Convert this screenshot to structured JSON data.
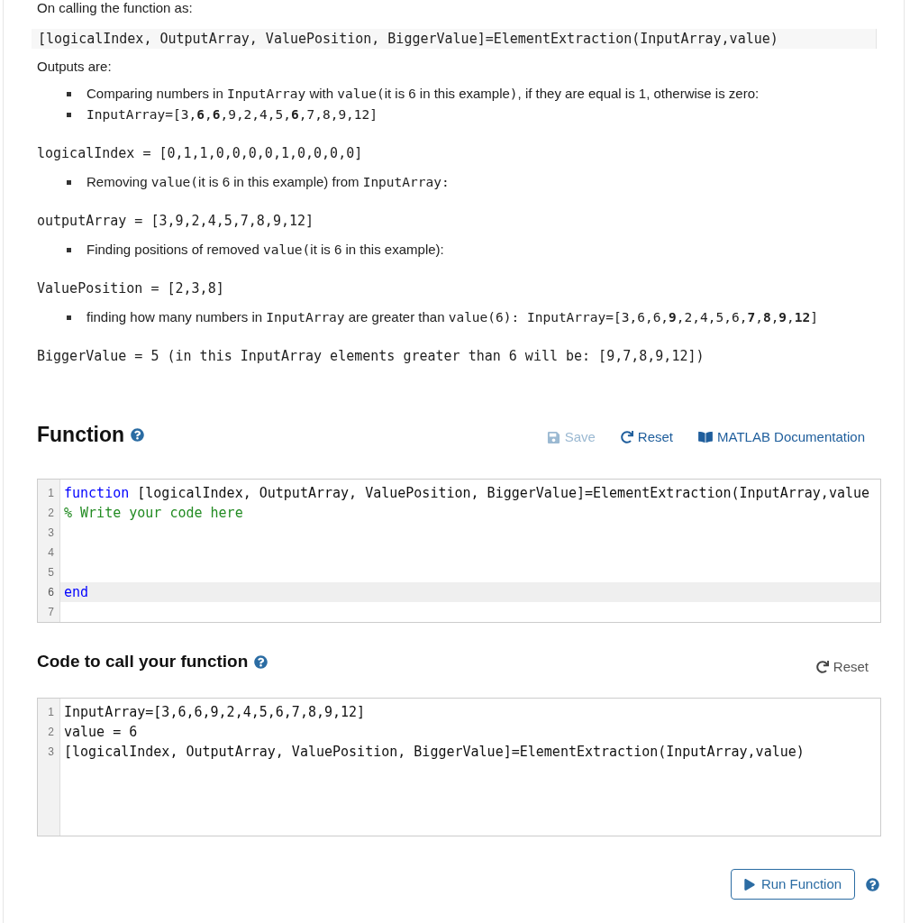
{
  "description": {
    "intro": "On calling the function as:",
    "call_code": "[logicalIndex, OutputArray, ValuePosition, BiggerValue]=ElementExtraction(InputArray,value)",
    "outputs_heading": "Outputs are:",
    "blocks": [
      {
        "kind": "bullets",
        "items": [
          {
            "segments": [
              {
                "kind": "text",
                "text": "Comparing numbers in "
              },
              {
                "kind": "code",
                "text": "InputArray"
              },
              {
                "kind": "text",
                "text": " with "
              },
              {
                "kind": "code",
                "text": "value("
              },
              {
                "kind": "text",
                "text": "it is 6 in this example"
              },
              {
                "kind": "code",
                "text": ")"
              },
              {
                "kind": "text",
                "text": ", if they are equal is 1, otherwise is zero:"
              }
            ]
          },
          {
            "segments": [
              {
                "kind": "code",
                "text": "InputArray=[3,**6**,**6**,9,2,4,5,**6**,7,8,9,12]"
              }
            ]
          }
        ]
      },
      {
        "kind": "result",
        "text": "logicalIndex = [0,1,1,0,0,0,0,1,0,0,0,0]"
      },
      {
        "kind": "bullets",
        "items": [
          {
            "segments": [
              {
                "kind": "text",
                "text": "Removing "
              },
              {
                "kind": "code",
                "text": "value("
              },
              {
                "kind": "text",
                "text": "it is 6 in this example) from "
              },
              {
                "kind": "code",
                "text": "InputArray:"
              }
            ]
          }
        ]
      },
      {
        "kind": "result",
        "text": "outputArray = [3,9,2,4,5,7,8,9,12]"
      },
      {
        "kind": "bullets",
        "items": [
          {
            "segments": [
              {
                "kind": "text",
                "text": "Finding positions of removed "
              },
              {
                "kind": "code",
                "text": "value("
              },
              {
                "kind": "text",
                "text": "it is 6 in this example):"
              }
            ]
          }
        ]
      },
      {
        "kind": "result",
        "text": "ValuePosition = [2,3,8]"
      },
      {
        "kind": "bullets",
        "items": [
          {
            "segments": [
              {
                "kind": "text",
                "text": "finding how many numbers in "
              },
              {
                "kind": "code",
                "text": "InputArray"
              },
              {
                "kind": "text",
                "text": " are greater than "
              },
              {
                "kind": "code",
                "text": "value(6): InputArray=[3,6,6,**9**,2,4,5,6,**7**,**8**,**9**,**12**]"
              }
            ]
          }
        ]
      },
      {
        "kind": "result",
        "text": "BiggerValue = 5 (in this InputArray elements greater than 6 will be: [9,7,8,9,12])"
      }
    ]
  },
  "function_section": {
    "title": "Function",
    "actions": [
      {
        "kind": "save",
        "label": "Save",
        "disabled": true
      },
      {
        "kind": "reset",
        "label": "Reset",
        "disabled": false
      },
      {
        "kind": "documentation",
        "label": "MATLAB Documentation",
        "disabled": false
      }
    ],
    "editor": {
      "lines": [
        {
          "number": "1",
          "active": false,
          "tokens": [
            {
              "kind": "keyword",
              "text": "function"
            },
            {
              "kind": "plain",
              "text": " [logicalIndex, OutputArray, ValuePosition, BiggerValue]=ElementExtraction(InputArray,value"
            }
          ]
        },
        {
          "number": "2",
          "active": false,
          "tokens": [
            {
              "kind": "comment",
              "text": "% Write your code here"
            }
          ]
        },
        {
          "number": "3",
          "active": false
        },
        {
          "number": "4",
          "active": false
        },
        {
          "number": "5",
          "active": false
        },
        {
          "number": "6",
          "active": true,
          "tokens": [
            {
              "kind": "keyword",
              "text": "end"
            }
          ]
        },
        {
          "number": "7",
          "active": false
        }
      ]
    }
  },
  "call_section": {
    "title": "Code to call your function",
    "reset": {
      "label": "Reset"
    },
    "editor": {
      "lines": [
        {
          "number": "1",
          "active": false,
          "tokens": [
            {
              "kind": "plain",
              "text": "InputArray=[3,6,6,9,2,4,5,6,7,8,9,12]"
            }
          ]
        },
        {
          "number": "2",
          "active": false,
          "tokens": [
            {
              "kind": "plain",
              "text": "value = 6"
            }
          ]
        },
        {
          "number": "3",
          "active": false,
          "tokens": [
            {
              "kind": "plain",
              "text": "[logicalIndex, OutputArray, ValuePosition, BiggerValue]=ElementExtraction(InputArray,value)"
            }
          ]
        }
      ]
    }
  },
  "run_button": {
    "label": "Run Function"
  }
}
